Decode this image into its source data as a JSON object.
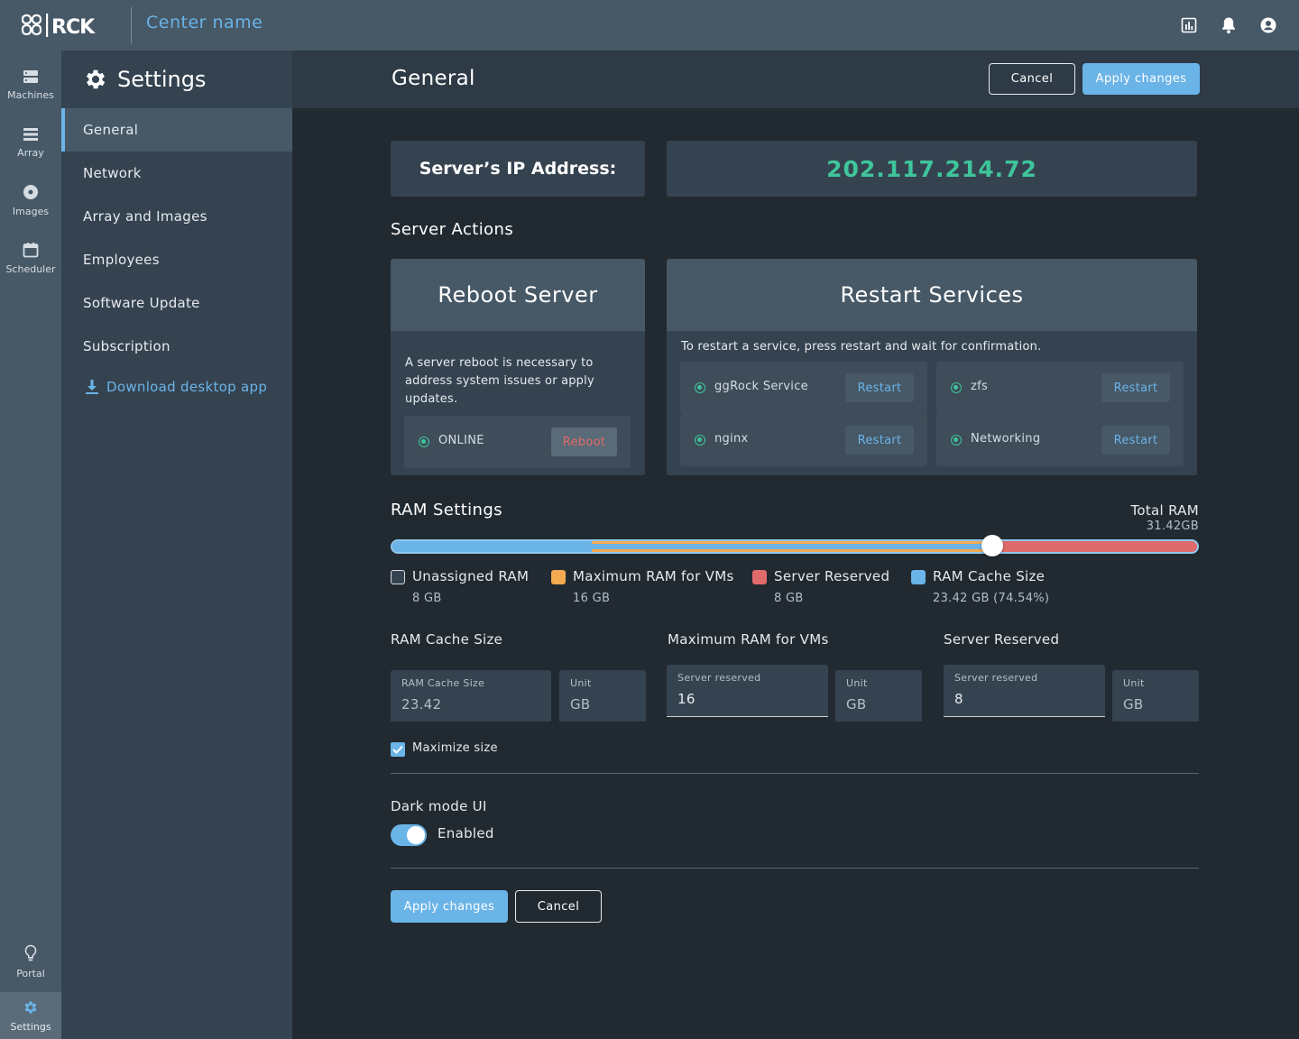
{
  "app": {
    "logo_text": "ggROCK",
    "center_name": "Center name"
  },
  "rail": {
    "items": [
      {
        "label": "Machines",
        "icon": "machines-icon"
      },
      {
        "label": "Array",
        "icon": "array-icon"
      },
      {
        "label": "Images",
        "icon": "images-icon"
      },
      {
        "label": "Scheduler",
        "icon": "scheduler-icon"
      },
      {
        "label": "Portal",
        "icon": "portal-icon"
      },
      {
        "label": "Settings",
        "icon": "settings-icon"
      }
    ]
  },
  "sidebar": {
    "title": "Settings",
    "items": [
      {
        "label": "General"
      },
      {
        "label": "Network"
      },
      {
        "label": "Array and Images"
      },
      {
        "label": "Employees"
      },
      {
        "label": "Software Update"
      },
      {
        "label": "Subscription"
      }
    ],
    "download_label": "Download desktop app"
  },
  "header": {
    "title": "General",
    "cancel_label": "Cancel",
    "apply_label": "Apply changes"
  },
  "ip": {
    "label": "Server’s IP Address:",
    "value": "202.117.214.72"
  },
  "server_actions": {
    "title": "Server Actions",
    "reboot": {
      "title": "Reboot Server",
      "description": "A server reboot is necessary to address system issues or apply updates.",
      "status": "ONLINE",
      "button": "Reboot"
    },
    "restart": {
      "title": "Restart Services",
      "description": "To restart a service, press restart and wait for confirmation.",
      "services": [
        {
          "name": "ggRock Service",
          "button": "Restart"
        },
        {
          "name": "zfs",
          "button": "Restart"
        },
        {
          "name": "nginx",
          "button": "Restart"
        },
        {
          "name": "Networking",
          "button": "Restart"
        }
      ]
    }
  },
  "ram": {
    "title": "RAM Settings",
    "total_label": "Total RAM",
    "total_value": "31.42GB",
    "slider": {
      "unassigned_fraction": 0.2483,
      "thumb_fraction": 0.7454
    },
    "legend": [
      {
        "label": "Unassigned RAM",
        "value": "8 GB",
        "color": "#354350"
      },
      {
        "label": "Maximum RAM for VMs",
        "value": "16 GB",
        "color": "#f2a950"
      },
      {
        "label": "Server Reserved",
        "value": "8 GB",
        "color": "#e06b6b"
      },
      {
        "label": "RAM Cache Size",
        "value": "23.42 GB (74.54%)",
        "color": "#6ab4e8"
      }
    ],
    "cache": {
      "title": "RAM Cache Size",
      "field_label": "RAM Cache Size",
      "field_value": "23.42",
      "unit_label": "Unit",
      "unit_value": "GB"
    },
    "vms": {
      "title": "Maximum RAM for VMs",
      "field_label": "Server reserved",
      "field_value": "16",
      "unit_label": "Unit",
      "unit_value": "GB"
    },
    "reserved": {
      "title": "Server Reserved",
      "field_label": "Server reserved",
      "field_value": "8",
      "unit_label": "Unit",
      "unit_value": "GB"
    },
    "maximize_label": "Maximize size",
    "maximize_checked": true
  },
  "dark_mode": {
    "title": "Dark mode UI",
    "toggle_label": "Enabled",
    "enabled": true
  },
  "footer": {
    "apply_label": "Apply changes",
    "cancel_label": "Cancel"
  },
  "colors": {
    "accent": "#6ab4e8",
    "online": "#3fc59b",
    "reboot": "#e06b6b",
    "vms": "#f2a950"
  }
}
